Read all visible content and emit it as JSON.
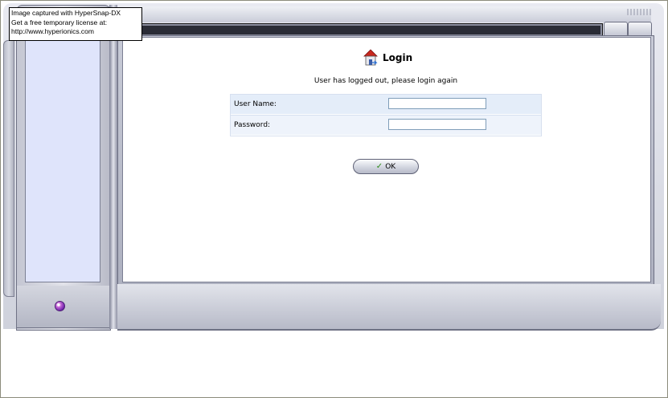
{
  "watermark": {
    "line1": "Image captured with HyperSnap-DX",
    "line2": "Get a free temporary license at:",
    "line3": "http://www.hyperionics.com"
  },
  "login": {
    "title": "Login",
    "title_icon": "house-icon",
    "message": "User has logged out, please login again",
    "username_label": "User Name:",
    "username_value": "",
    "password_label": "Password:",
    "password_value": "",
    "ok_label": "OK",
    "ok_icon": "check-icon"
  },
  "sidebar": {
    "orb_icon": "orb-icon"
  },
  "colors": {
    "sidebar_panel": "#dfe4fb",
    "form_row": "#e4edf9",
    "check": "#2e8b1a"
  }
}
